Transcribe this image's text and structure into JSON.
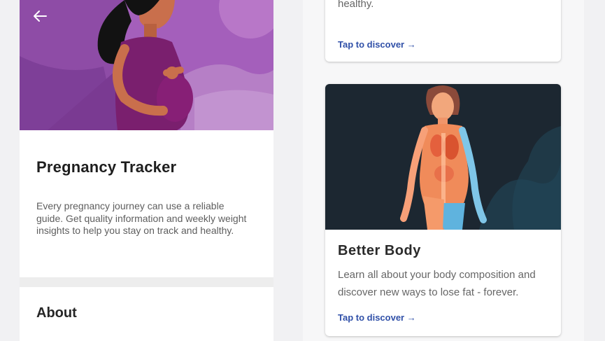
{
  "left": {
    "title": "Pregnancy Tracker",
    "description": "Every pregnancy journey can use a reliable guide. Get quality information and weekly weight insights to help you stay on track and healthy.",
    "about_title": "About"
  },
  "right": {
    "top_card": {
      "description": "weight insights to help you stay on track and healthy.",
      "link": "Tap to discover →"
    },
    "body_card": {
      "title": "Better Body",
      "description": "Learn all about your body composition and discover new ways to lose fat - forever.",
      "link": "Tap to discover →"
    }
  },
  "icons": {
    "back": "back-arrow-icon"
  },
  "colors": {
    "hero_purple": "#a05fb8",
    "link_blue": "#3050a8",
    "body_card_bg": "#1c2731"
  }
}
